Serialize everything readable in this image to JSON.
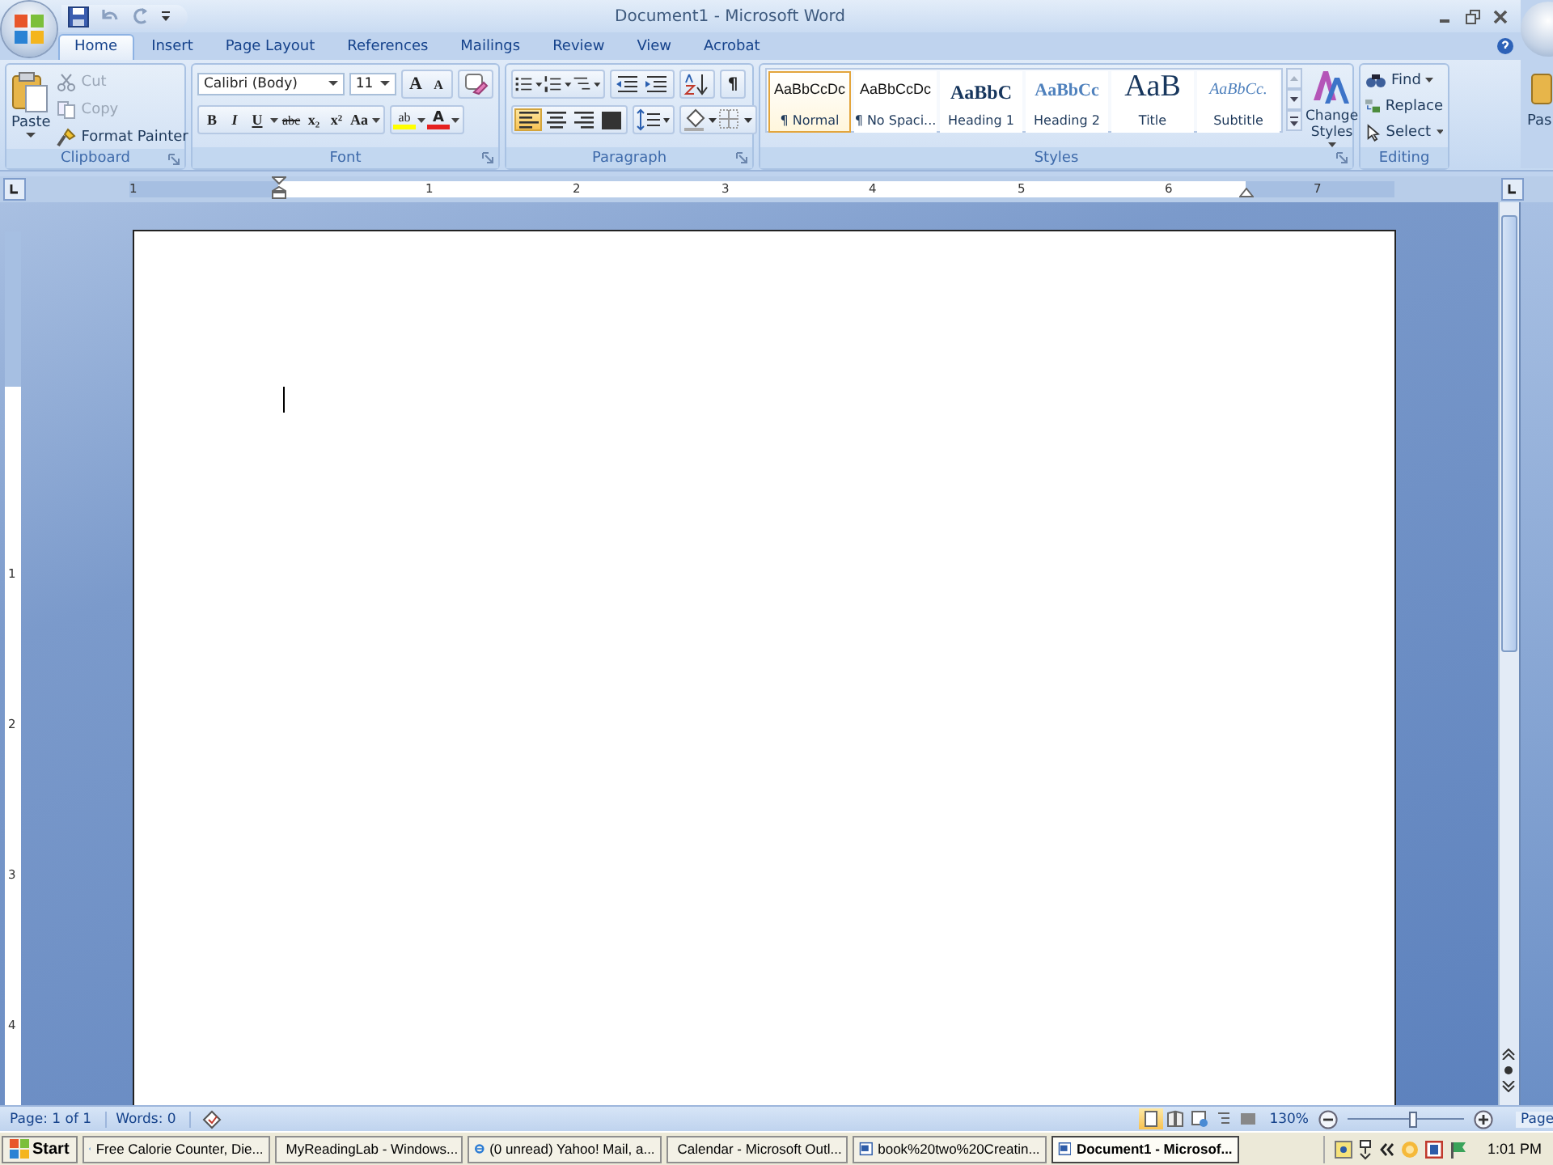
{
  "window": {
    "title": "Document1 - Microsoft Word"
  },
  "tabs": [
    {
      "label": "Home",
      "selected": true
    },
    {
      "label": "Insert",
      "selected": false
    },
    {
      "label": "Page Layout",
      "selected": false
    },
    {
      "label": "References",
      "selected": false
    },
    {
      "label": "Mailings",
      "selected": false
    },
    {
      "label": "Review",
      "selected": false
    },
    {
      "label": "View",
      "selected": false
    },
    {
      "label": "Acrobat",
      "selected": false
    }
  ],
  "ribbon": {
    "clipboard": {
      "label": "Clipboard",
      "paste": "Paste",
      "cut": {
        "label": "Cut",
        "disabled": true
      },
      "copy": {
        "label": "Copy",
        "disabled": true
      },
      "format_painter": "Format Painter"
    },
    "font": {
      "label": "Font",
      "family": "Calibri (Body)",
      "size": "11",
      "grow": "A",
      "shrink": "A",
      "bold": "B",
      "italic": "I",
      "underline": "U",
      "strike": "abc",
      "subscript": "x₂",
      "superscript": "x²",
      "change_case": "Aa",
      "highlight": "ab",
      "font_color": "A"
    },
    "paragraph": {
      "label": "Paragraph",
      "show_marks": "¶",
      "alignment": [
        {
          "kind": "left",
          "selected": true
        },
        {
          "kind": "center",
          "selected": false
        },
        {
          "kind": "right",
          "selected": false
        },
        {
          "kind": "justify",
          "selected": false
        }
      ]
    },
    "styles": {
      "label": "Styles",
      "gallery": [
        {
          "kind": "normal",
          "sample": "AaBbCcDc",
          "name": "¶ Normal",
          "selected": true
        },
        {
          "kind": "normal",
          "sample": "AaBbCcDc",
          "name": "¶ No Spaci...",
          "selected": false
        },
        {
          "kind": "heading1",
          "sample": "AaBbC",
          "name": "Heading 1",
          "selected": false
        },
        {
          "kind": "heading2",
          "sample": "AaBbCc",
          "name": "Heading 2",
          "selected": false
        },
        {
          "kind": "title",
          "sample": "AaB",
          "name": "Title",
          "selected": false
        },
        {
          "kind": "subtitle",
          "sample": "AaBbCc.",
          "name": "Subtitle",
          "selected": false
        }
      ],
      "change_styles": "Change Styles"
    },
    "editing": {
      "label": "Editing",
      "find": "Find",
      "replace": "Replace",
      "select": "Select"
    }
  },
  "ruler": {
    "numbers": [
      "1",
      "1",
      "2",
      "3",
      "4",
      "5",
      "6",
      "7"
    ]
  },
  "vertical_ruler": {
    "numbers": [
      "1",
      "2",
      "3",
      "4"
    ]
  },
  "status_bar": {
    "page": "Page: 1 of 1",
    "words": "Words: 0",
    "views": [
      {
        "kind": "print",
        "selected": true
      },
      {
        "kind": "reading",
        "selected": false
      },
      {
        "kind": "web",
        "selected": false
      },
      {
        "kind": "outline",
        "selected": false
      },
      {
        "kind": "draft",
        "selected": false
      }
    ],
    "zoom": "130%",
    "zoom_slider": {
      "level": 0.55
    }
  },
  "taskbar": {
    "start": "Start",
    "tasks": [
      {
        "kind": "browser",
        "label": "Free Calorie Counter, Die...",
        "selected": false
      },
      {
        "kind": "browser",
        "label": "MyReadingLab - Windows...",
        "selected": false
      },
      {
        "kind": "browser",
        "label": "(0 unread) Yahoo! Mail, a...",
        "selected": false
      },
      {
        "kind": "calendar",
        "label": "Calendar - Microsoft Outl...",
        "selected": false
      },
      {
        "kind": "document",
        "label": "book%20two%20Creatin...",
        "selected": false
      },
      {
        "kind": "document",
        "label": "Document1 - Microsof...",
        "selected": true
      }
    ],
    "clock": "1:01 PM"
  },
  "background_window": {
    "paste": "Pas",
    "status": "Page"
  }
}
